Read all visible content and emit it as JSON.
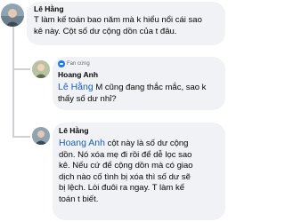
{
  "comments": [
    {
      "author": "Lê Hằng",
      "lines": [
        "T làm kế toán bao năm mà k hiểu nổi cái sao",
        "kê này. Cột số dư cộng dồn của t đâu."
      ]
    },
    {
      "badge": "Fan cứng",
      "author": "Hoang Anh",
      "mention": "Lê Hằng",
      "lines_after_mention": [
        " M cũng đang thắc mắc, sao k",
        "thấy số dư nhỉ?"
      ]
    },
    {
      "author": "Lê Hằng",
      "mention": "Hoang Anh",
      "lines_after_mention": [
        " cột này là số dư cộng",
        "dồn. Nó xóa mẹ đi rồi để dễ lọc sao",
        "kê. Nếu cứ để cộng dồn mà có giao",
        "dịch nào cố tình bị xóa thì số dư sẽ",
        "bị lệch. Lòi đuôi ra ngay. T làm kế",
        "toán t biết."
      ]
    }
  ],
  "colors": {
    "bubble": "#f0f2f5",
    "mention": "#1a5fb4",
    "badge": "#1877f2",
    "thread_line": "#ced0d4"
  }
}
